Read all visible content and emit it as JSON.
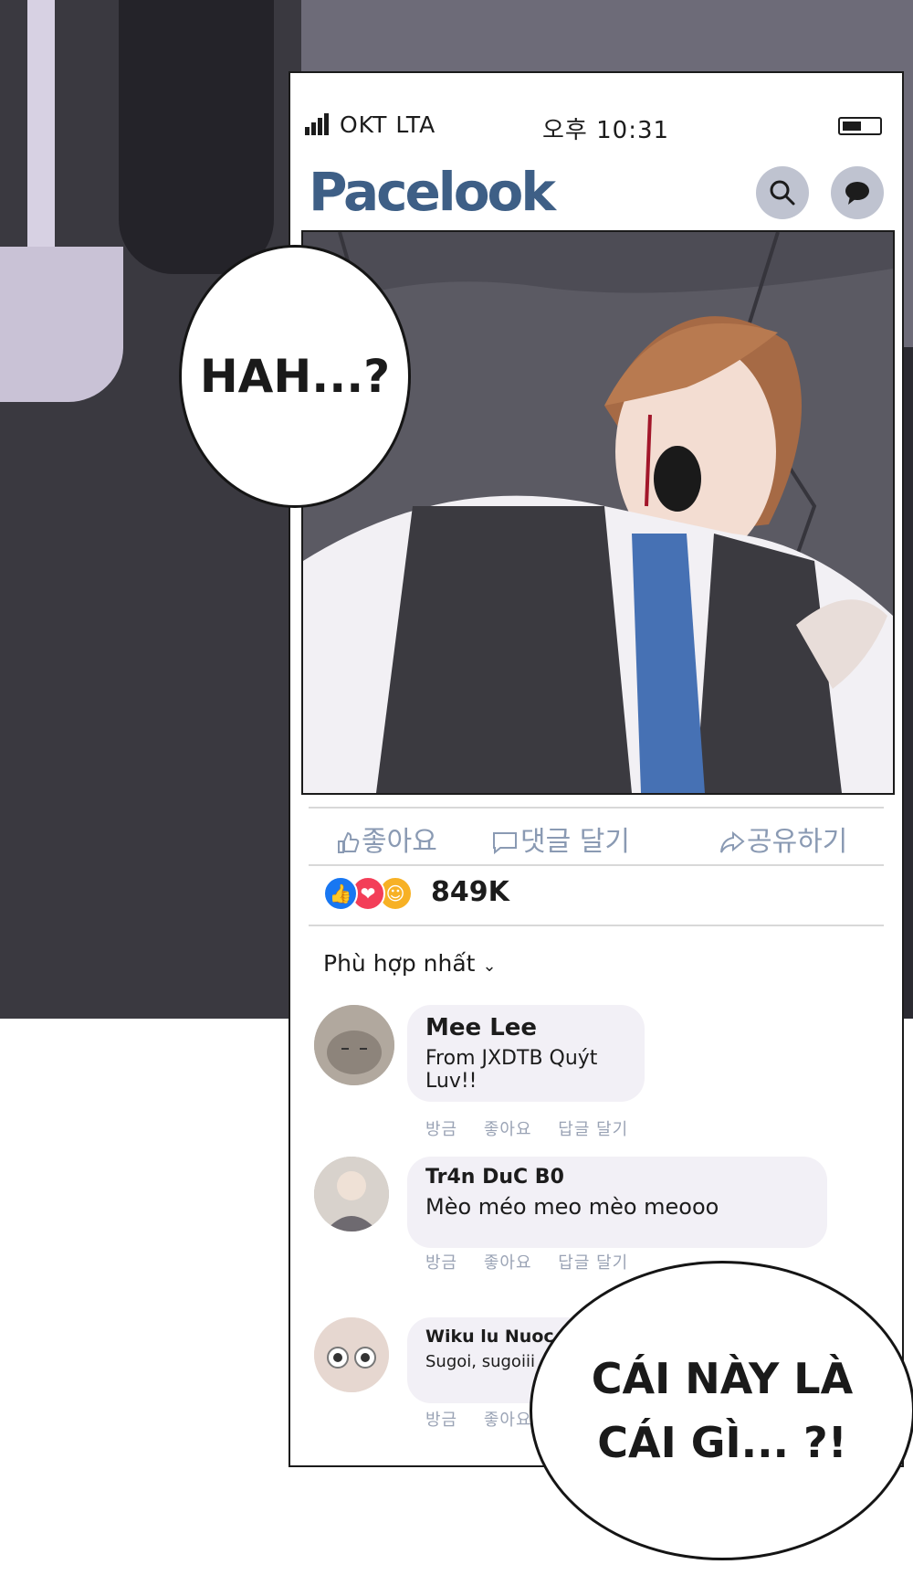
{
  "status_bar": {
    "carrier": "OKT  LTA",
    "time": "오후  10:31"
  },
  "app": {
    "brand": "Pacelook",
    "search_icon": "search-icon",
    "chat_icon": "chat-bubble-icon"
  },
  "post": {
    "image_description_icon": "post-image",
    "actions": {
      "like": "좋아요",
      "comment": "댓글 달기",
      "share": "공유하기"
    },
    "reactions": {
      "icons": [
        "like-icon",
        "love-icon",
        "care-icon"
      ],
      "count": "849K"
    }
  },
  "comments_section": {
    "sort_label": "Phù hợp nhất",
    "comments": [
      {
        "name": "Mee Lee",
        "text": "From JXDTB Quýt Luv!!",
        "meta_time": "방금",
        "meta_like": "좋아요",
        "meta_reply": "답글 달기"
      },
      {
        "name": "Tr4n DuC B0",
        "text": "Mèo méo meo mèo meooo",
        "meta_time": "방금",
        "meta_like": "좋아요",
        "meta_reply": "답글 달기"
      },
      {
        "name": "Wiku lu Nuoc",
        "text": "Sugoi, sugoiii",
        "meta_time": "방금",
        "meta_like": "좋아요"
      }
    ]
  },
  "speech_bubbles": {
    "first": "HAH...?",
    "second_line1": "CÁI NÀY LÀ",
    "second_line2": "CÁI GÌ... ?!"
  },
  "colors": {
    "brand": "#3e5f86",
    "action_text": "#8a9ab3",
    "like_blue": "#1877f2",
    "love_red": "#f33e58",
    "care_yellow": "#f7b125"
  }
}
